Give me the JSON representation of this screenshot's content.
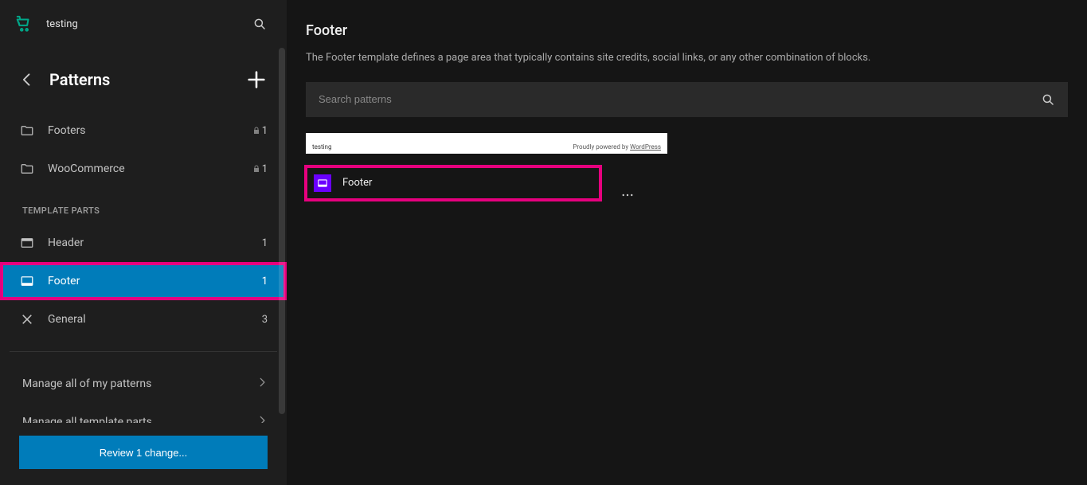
{
  "site_name": "testing",
  "sidebar": {
    "title": "Patterns",
    "groups_label": "TEMPLATE PARTS",
    "items_top": [
      {
        "label": "Footers",
        "count": "1",
        "locked": true
      },
      {
        "label": "WooCommerce",
        "count": "1",
        "locked": true
      }
    ],
    "items_template_parts": [
      {
        "label": "Header",
        "count": "1"
      },
      {
        "label": "Footer",
        "count": "1"
      },
      {
        "label": "General",
        "count": "3"
      }
    ],
    "manage_patterns": "Manage all of my patterns",
    "manage_template_parts": "Manage all template parts",
    "review_button": "Review 1 change..."
  },
  "main": {
    "title": "Footer",
    "description": "The Footer template defines a page area that typically contains site credits, social links, or any other combination of blocks.",
    "search_placeholder": "Search patterns",
    "card": {
      "preview_site": "testing",
      "preview_powered_prefix": "Proudly powered by ",
      "preview_powered_link": "WordPress",
      "label": "Footer"
    }
  }
}
